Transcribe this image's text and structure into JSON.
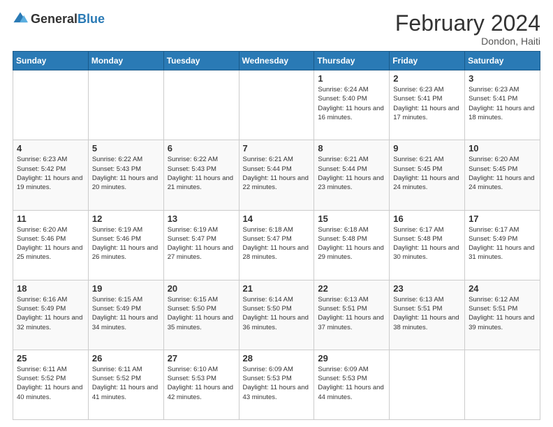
{
  "logo": {
    "text_general": "General",
    "text_blue": "Blue"
  },
  "header": {
    "month_year": "February 2024",
    "location": "Dondon, Haiti"
  },
  "weekdays": [
    "Sunday",
    "Monday",
    "Tuesday",
    "Wednesday",
    "Thursday",
    "Friday",
    "Saturday"
  ],
  "weeks": [
    [
      {
        "day": "",
        "info": ""
      },
      {
        "day": "",
        "info": ""
      },
      {
        "day": "",
        "info": ""
      },
      {
        "day": "",
        "info": ""
      },
      {
        "day": "1",
        "info": "Sunrise: 6:24 AM\nSunset: 5:40 PM\nDaylight: 11 hours and 16 minutes."
      },
      {
        "day": "2",
        "info": "Sunrise: 6:23 AM\nSunset: 5:41 PM\nDaylight: 11 hours and 17 minutes."
      },
      {
        "day": "3",
        "info": "Sunrise: 6:23 AM\nSunset: 5:41 PM\nDaylight: 11 hours and 18 minutes."
      }
    ],
    [
      {
        "day": "4",
        "info": "Sunrise: 6:23 AM\nSunset: 5:42 PM\nDaylight: 11 hours and 19 minutes."
      },
      {
        "day": "5",
        "info": "Sunrise: 6:22 AM\nSunset: 5:43 PM\nDaylight: 11 hours and 20 minutes."
      },
      {
        "day": "6",
        "info": "Sunrise: 6:22 AM\nSunset: 5:43 PM\nDaylight: 11 hours and 21 minutes."
      },
      {
        "day": "7",
        "info": "Sunrise: 6:21 AM\nSunset: 5:44 PM\nDaylight: 11 hours and 22 minutes."
      },
      {
        "day": "8",
        "info": "Sunrise: 6:21 AM\nSunset: 5:44 PM\nDaylight: 11 hours and 23 minutes."
      },
      {
        "day": "9",
        "info": "Sunrise: 6:21 AM\nSunset: 5:45 PM\nDaylight: 11 hours and 24 minutes."
      },
      {
        "day": "10",
        "info": "Sunrise: 6:20 AM\nSunset: 5:45 PM\nDaylight: 11 hours and 24 minutes."
      }
    ],
    [
      {
        "day": "11",
        "info": "Sunrise: 6:20 AM\nSunset: 5:46 PM\nDaylight: 11 hours and 25 minutes."
      },
      {
        "day": "12",
        "info": "Sunrise: 6:19 AM\nSunset: 5:46 PM\nDaylight: 11 hours and 26 minutes."
      },
      {
        "day": "13",
        "info": "Sunrise: 6:19 AM\nSunset: 5:47 PM\nDaylight: 11 hours and 27 minutes."
      },
      {
        "day": "14",
        "info": "Sunrise: 6:18 AM\nSunset: 5:47 PM\nDaylight: 11 hours and 28 minutes."
      },
      {
        "day": "15",
        "info": "Sunrise: 6:18 AM\nSunset: 5:48 PM\nDaylight: 11 hours and 29 minutes."
      },
      {
        "day": "16",
        "info": "Sunrise: 6:17 AM\nSunset: 5:48 PM\nDaylight: 11 hours and 30 minutes."
      },
      {
        "day": "17",
        "info": "Sunrise: 6:17 AM\nSunset: 5:49 PM\nDaylight: 11 hours and 31 minutes."
      }
    ],
    [
      {
        "day": "18",
        "info": "Sunrise: 6:16 AM\nSunset: 5:49 PM\nDaylight: 11 hours and 32 minutes."
      },
      {
        "day": "19",
        "info": "Sunrise: 6:15 AM\nSunset: 5:49 PM\nDaylight: 11 hours and 34 minutes."
      },
      {
        "day": "20",
        "info": "Sunrise: 6:15 AM\nSunset: 5:50 PM\nDaylight: 11 hours and 35 minutes."
      },
      {
        "day": "21",
        "info": "Sunrise: 6:14 AM\nSunset: 5:50 PM\nDaylight: 11 hours and 36 minutes."
      },
      {
        "day": "22",
        "info": "Sunrise: 6:13 AM\nSunset: 5:51 PM\nDaylight: 11 hours and 37 minutes."
      },
      {
        "day": "23",
        "info": "Sunrise: 6:13 AM\nSunset: 5:51 PM\nDaylight: 11 hours and 38 minutes."
      },
      {
        "day": "24",
        "info": "Sunrise: 6:12 AM\nSunset: 5:51 PM\nDaylight: 11 hours and 39 minutes."
      }
    ],
    [
      {
        "day": "25",
        "info": "Sunrise: 6:11 AM\nSunset: 5:52 PM\nDaylight: 11 hours and 40 minutes."
      },
      {
        "day": "26",
        "info": "Sunrise: 6:11 AM\nSunset: 5:52 PM\nDaylight: 11 hours and 41 minutes."
      },
      {
        "day": "27",
        "info": "Sunrise: 6:10 AM\nSunset: 5:53 PM\nDaylight: 11 hours and 42 minutes."
      },
      {
        "day": "28",
        "info": "Sunrise: 6:09 AM\nSunset: 5:53 PM\nDaylight: 11 hours and 43 minutes."
      },
      {
        "day": "29",
        "info": "Sunrise: 6:09 AM\nSunset: 5:53 PM\nDaylight: 11 hours and 44 minutes."
      },
      {
        "day": "",
        "info": ""
      },
      {
        "day": "",
        "info": ""
      }
    ]
  ]
}
